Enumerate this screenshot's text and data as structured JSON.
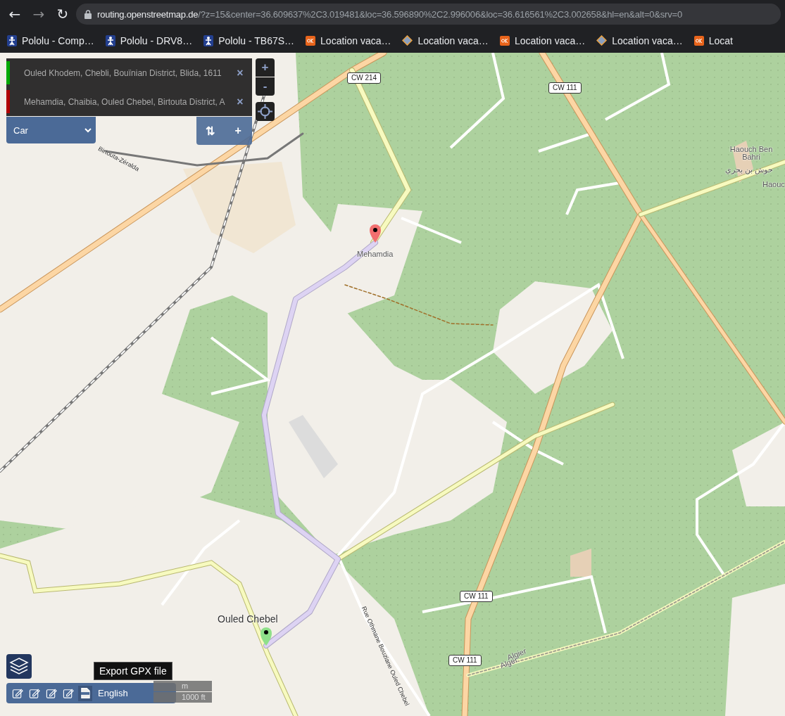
{
  "browser": {
    "nav": [
      "←",
      "→",
      "↻"
    ],
    "url_host": "routing.openstreetmap.de",
    "url_rest": "/?z=15&center=36.609637%2C3.019481&loc=36.596890%2C2.996006&loc=36.616561%2C3.002658&hl=en&alt=0&srv=0"
  },
  "bookmarks": [
    {
      "label": "Pololu - Comp…",
      "kind": "pololu"
    },
    {
      "label": "Pololu - DRV8…",
      "kind": "pololu"
    },
    {
      "label": "Pololu - TB67S…",
      "kind": "pololu"
    },
    {
      "label": "Location vaca…",
      "kind": "ok"
    },
    {
      "label": "Location vaca…",
      "kind": "diamond"
    },
    {
      "label": "Location vaca…",
      "kind": "ok"
    },
    {
      "label": "Location vaca…",
      "kind": "diamond"
    },
    {
      "label": "Locat",
      "kind": "ok"
    }
  ],
  "waypoints": [
    {
      "value": "Ouled Khodem, Chebli, Bouïnian District, Blida, 1611",
      "color": "#00a800",
      "remove": "×"
    },
    {
      "value": "Mehamdia, Chaibia, Ouled Chebel, Birtouta District, A",
      "color": "#b00000",
      "remove": "×"
    }
  ],
  "profile": "Car",
  "route_buttons": [
    "⇅",
    "+"
  ],
  "zoom_buttons": [
    "+",
    "-"
  ],
  "map_labels": [
    {
      "text": "CW 214",
      "kind": "shield"
    },
    {
      "text": "CW 111",
      "kind": "shield"
    },
    {
      "text": "CW 111",
      "kind": "shield"
    },
    {
      "text": "CW 111",
      "kind": "shield"
    },
    {
      "text": "Haouch Ben Bahri",
      "kind": "place"
    },
    {
      "text": "حوش بن بحري",
      "kind": "place"
    },
    {
      "text": "Haouc",
      "kind": "place"
    },
    {
      "text": "Mehamdia",
      "kind": "place"
    },
    {
      "text": "Ouled Chebel",
      "kind": "town"
    },
    {
      "text": "Rue Othmane Bouziane Ouled Chebel",
      "kind": "street"
    },
    {
      "text": "Algier",
      "kind": "place"
    },
    {
      "text": "Alger",
      "kind": "place"
    },
    {
      "text": "Birtouta-Zéralda",
      "kind": "street"
    }
  ],
  "language": "English",
  "scale": {
    "metric": "m",
    "imperial": "1000 ft"
  },
  "tooltip": "Export GPX file"
}
